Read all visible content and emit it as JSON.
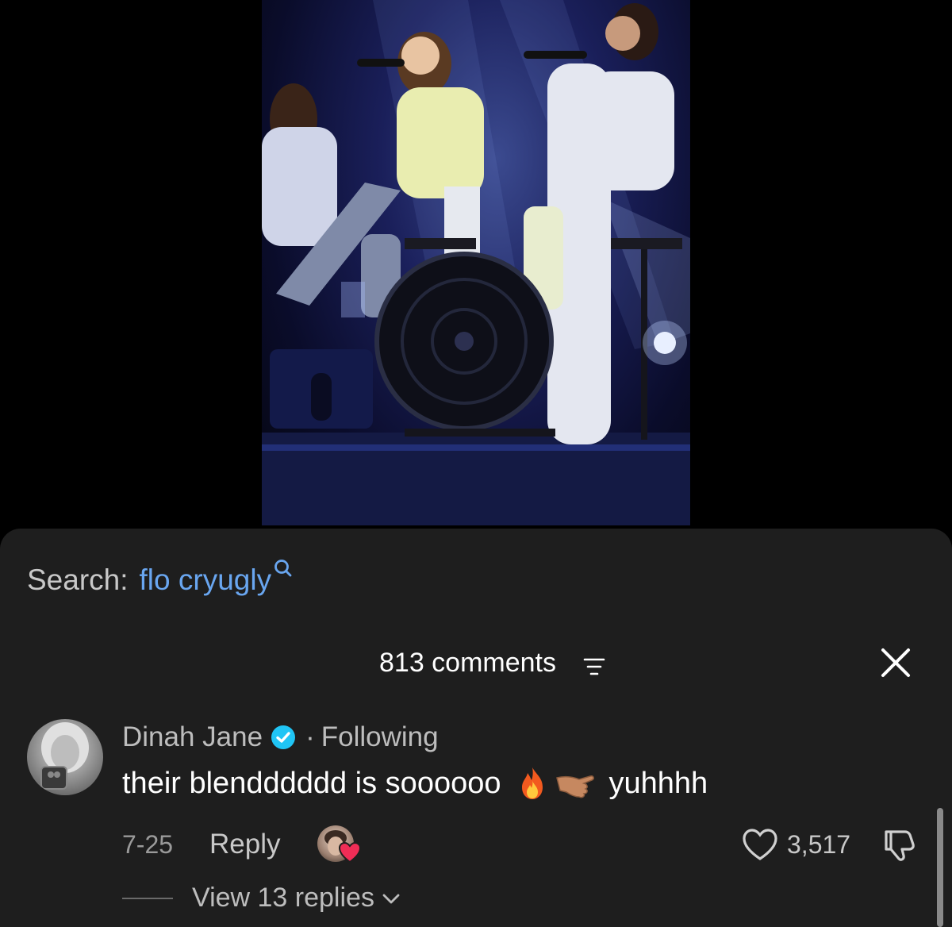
{
  "video": {
    "accent_stage": "#1d2a6e"
  },
  "search": {
    "label": "Search:",
    "term": "flo cryugly",
    "term_color": "#69a6f0"
  },
  "comments_header": {
    "count_label": "813 comments"
  },
  "comment": {
    "username": "Dinah Jane",
    "follow_status": "Following",
    "separator": "·",
    "text_main": "their blendddddd is soooooo",
    "emoji_1": "fire-icon",
    "emoji_2": "pointing-hand-icon",
    "text_tail": "yuhhhh",
    "date": "7-25",
    "reply_label": "Reply",
    "like_count": "3,517",
    "view_replies_label": "View 13 replies"
  },
  "colors": {
    "sheet_bg": "#1e1e1e",
    "verified_blue": "#20c5f5",
    "heart_red": "#f02d56"
  }
}
